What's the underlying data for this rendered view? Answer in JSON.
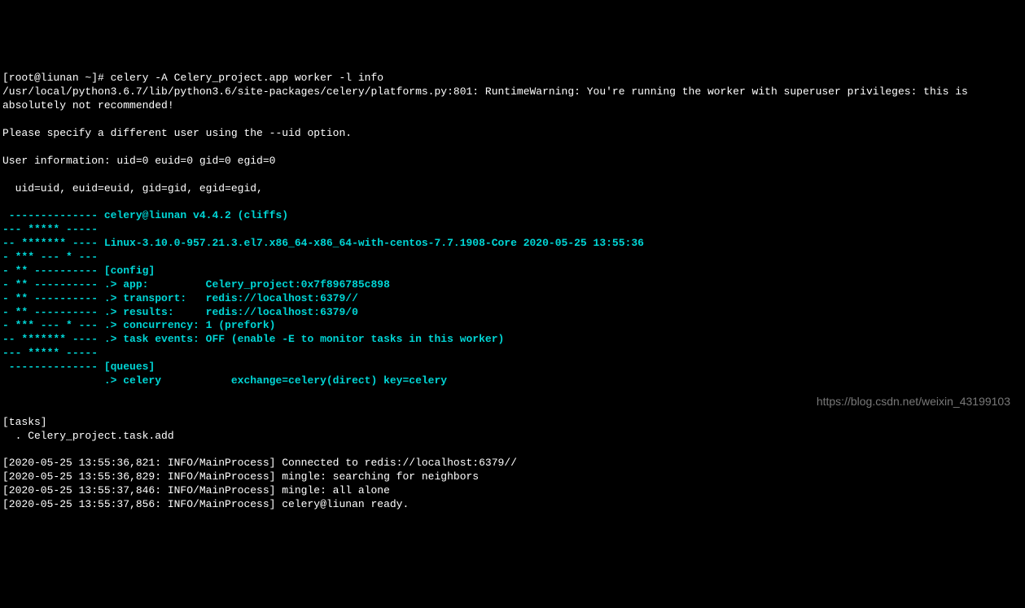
{
  "prompt": {
    "user_host": "[root@liunan ~]# ",
    "command": "celery -A Celery_project.app worker -l info"
  },
  "warning": {
    "line1": "/usr/local/python3.6.7/lib/python3.6/site-packages/celery/platforms.py:801: RuntimeWarning: You're running the worker with superuser privileges: this is",
    "line2": "absolutely not recommended!",
    "blank1": "",
    "line3": "Please specify a different user using the --uid option.",
    "blank2": "",
    "line4": "User information: uid=0 euid=0 gid=0 egid=0",
    "blank3": "",
    "line5": "  uid=uid, euid=euid, gid=gid, egid=egid,"
  },
  "banner": {
    "l01": " -------------- celery@liunan v4.4.2 (cliffs)",
    "l02": "--- ***** -----",
    "l03": "-- ******* ---- Linux-3.10.0-957.21.3.el7.x86_64-x86_64-with-centos-7.7.1908-Core 2020-05-25 13:55:36",
    "l04": "- *** --- * ---",
    "l05": "- ** ---------- [config]",
    "l06": "- ** ---------- .> app:         Celery_project:0x7f896785c898",
    "l07": "- ** ---------- .> transport:   redis://localhost:6379//",
    "l08": "- ** ---------- .> results:     redis://localhost:6379/0",
    "l09": "- *** --- * --- .> concurrency: 1 (prefork)",
    "l10": "-- ******* ---- .> task events: OFF (enable -E to monitor tasks in this worker)",
    "l11": "--- ***** -----",
    "l12": " -------------- [queues]",
    "l13": "                .> celery           exchange=celery(direct) key=celery"
  },
  "tasks": {
    "header": "[tasks]",
    "item1": "  . Celery_project.task.add"
  },
  "logs": {
    "l1": "[2020-05-25 13:55:36,821: INFO/MainProcess] Connected to redis://localhost:6379//",
    "l2": "[2020-05-25 13:55:36,829: INFO/MainProcess] mingle: searching for neighbors",
    "l3": "[2020-05-25 13:55:37,846: INFO/MainProcess] mingle: all alone",
    "l4": "[2020-05-25 13:55:37,856: INFO/MainProcess] celery@liunan ready."
  },
  "watermark": "https://blog.csdn.net/weixin_43199103"
}
